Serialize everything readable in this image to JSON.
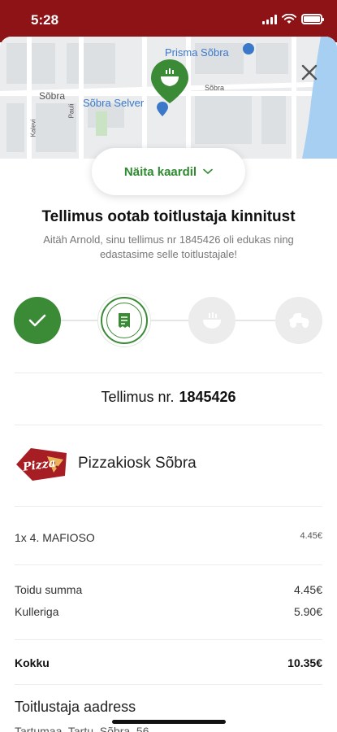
{
  "status_bar": {
    "time": "5:28"
  },
  "map": {
    "poi_prisma": "Prisma Sõbra",
    "poi_selver": "Sõbra Selver",
    "street_sobra_left": "Sõbra",
    "street_sobra_right": "Sõbra",
    "street_kalevi": "Kalevi",
    "street_pauli": "Pauli"
  },
  "show_map_button": "Näita kaardil",
  "title": "Tellimus ootab toitlustaja kinnitust",
  "subtitle": "Aitäh Arnold, sinu tellimus nr 1845426 oli edukas ning edastasime selle toitlustajale!",
  "steps": {
    "icons": [
      "check-icon",
      "receipt-icon",
      "bowl-icon",
      "scooter-icon"
    ],
    "current_index": 1,
    "colors": {
      "active": "#3a8a36",
      "inactive": "#ececec"
    }
  },
  "order": {
    "label": "Tellimus nr.",
    "number": "1845426"
  },
  "restaurant": {
    "logo_text": "Pizza",
    "name": "Pizzakiosk Sõbra"
  },
  "items": [
    {
      "label": "1x 4. MAFIOSO",
      "price": "4.45€"
    }
  ],
  "summary": {
    "food_sum_label": "Toidu summa",
    "food_sum": "4.45€",
    "courier_label": "Kulleriga",
    "courier": "5.90€",
    "total_label": "Kokku",
    "total": "10.35€"
  },
  "address": {
    "title": "Toitlustaja aadress",
    "value": "Tartumaa, Tartu, Sõbra, 56"
  },
  "colors": {
    "brand": "#8e1316",
    "accent": "#3a8a36"
  }
}
